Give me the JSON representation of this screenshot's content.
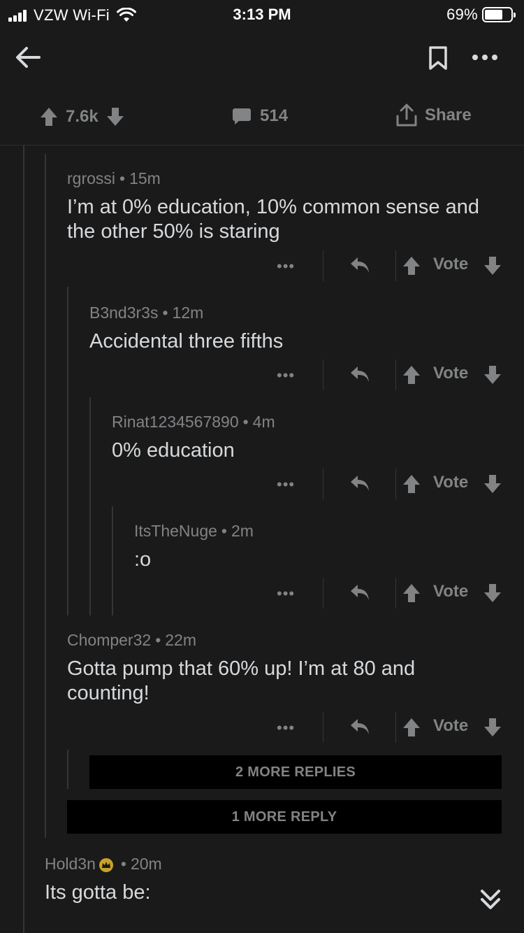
{
  "status": {
    "carrier": "VZW Wi-Fi",
    "time": "3:13 PM",
    "battery": "69%",
    "battery_level": 0.69
  },
  "post_bar": {
    "score": "7.6k",
    "comments": "514",
    "share_label": "Share"
  },
  "comments": [
    {
      "author": "rgrossi",
      "age": "15m",
      "body": "I’m at 0% education, 10% common sense and the other 50% is staring"
    },
    {
      "author": "B3nd3r3s",
      "age": "12m",
      "body": "Accidental three fifths"
    },
    {
      "author": "Rinat1234567890",
      "age": "4m",
      "body": "0% education"
    },
    {
      "author": "ItsTheNuge",
      "age": "2m",
      "body": ":o"
    },
    {
      "author": "Chomper32",
      "age": "22m",
      "body": "Gotta pump that 60% up! I’m at 80 and counting!"
    },
    {
      "author": "Hold3n",
      "age": "20m",
      "body": "Its gotta be:"
    }
  ],
  "action_labels": {
    "more": "•••",
    "vote": "Vote",
    "dot": "•"
  },
  "more_replies": {
    "two": "2 MORE REPLIES",
    "one": "1 MORE REPLY"
  },
  "colors": {
    "background": "#1a1a1b",
    "text": "#d7dadc",
    "muted": "#818384",
    "thread": "#343536"
  }
}
